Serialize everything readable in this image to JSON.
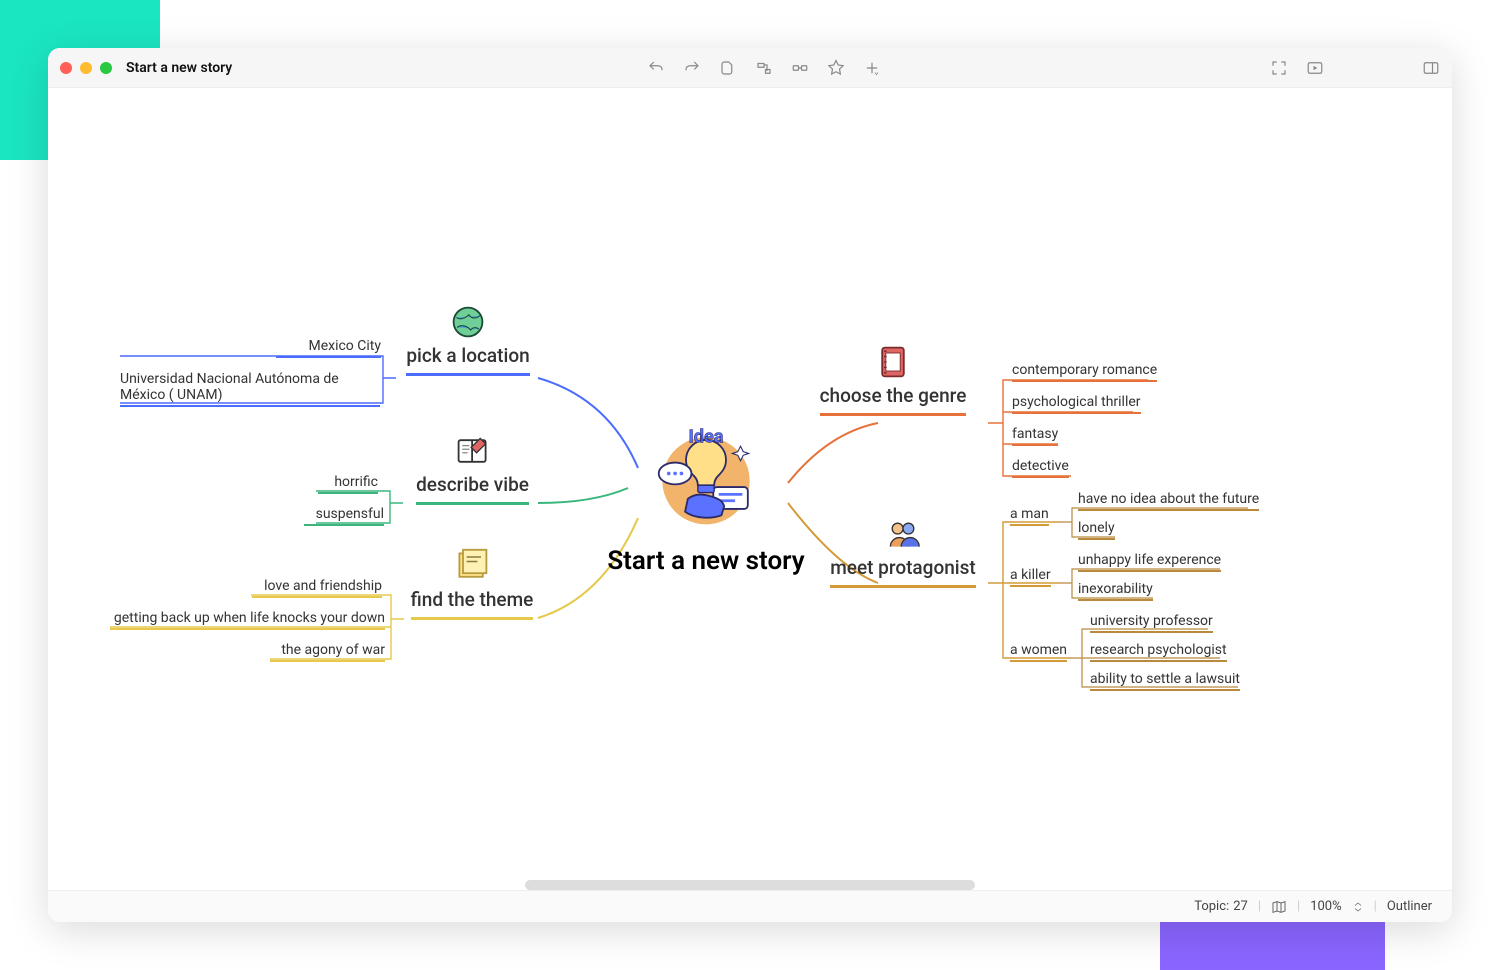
{
  "window": {
    "title": "Start a new story"
  },
  "central": {
    "label": "Start a new story"
  },
  "left": {
    "location": {
      "label": "pick a location",
      "children": [
        "Mexico City",
        "Universidad Nacional Autónoma de México ( UNAM)"
      ]
    },
    "vibe": {
      "label": "describe vibe",
      "children": [
        "horrific",
        "suspensful"
      ]
    },
    "theme": {
      "label": "find the theme",
      "children": [
        "love and friendship",
        "getting back up when life knocks your down",
        "the agony of war"
      ]
    }
  },
  "right": {
    "genre": {
      "label": "choose the genre",
      "children": [
        "contemporary romance",
        "psychological thriller",
        "fantasy",
        "detective"
      ]
    },
    "protagonist": {
      "label": "meet protagonist",
      "man": {
        "label": "a  man",
        "children": [
          "have no idea about the future",
          "lonely"
        ]
      },
      "killer": {
        "label": "a  killer",
        "children": [
          "unhappy life experence",
          "inexorability"
        ]
      },
      "women": {
        "label": "a  women",
        "children": [
          "university professor",
          "research psychologist",
          "ability to settle a lawsuit"
        ]
      }
    }
  },
  "status": {
    "topic_label": "Topic:",
    "topic_count": "27",
    "zoom": "100%",
    "outliner": "Outliner"
  },
  "colors": {
    "blue": "#4b6cff",
    "green": "#3bb77e",
    "yellow": "#e6c84b",
    "orange": "#e6713b",
    "ochre": "#d49a38",
    "brown": "#b98a3e"
  }
}
